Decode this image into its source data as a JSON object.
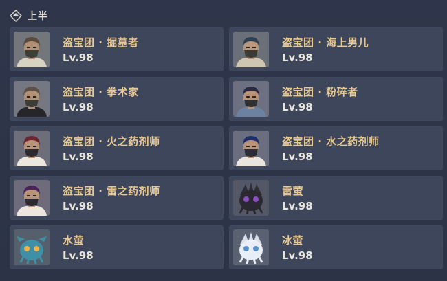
{
  "header": {
    "title": "上半",
    "icon": "diamond-icon"
  },
  "enemies": [
    {
      "name": "盗宝团 · 掘墓者",
      "level": "Lv.98",
      "portrait": "treasure-hoarder-gravedigger-icon",
      "colors": {
        "bg": "#73767a",
        "hair": "#5a4a3c",
        "skin": "#b08f74",
        "clothes": "#d8d2c2",
        "mask": "#3c3f36"
      }
    },
    {
      "name": "盗宝团 · 海上男儿",
      "level": "Lv.98",
      "portrait": "treasure-hoarder-seaman-icon",
      "colors": {
        "bg": "#6a6f78",
        "hair": "#2f3f52",
        "skin": "#b8977c",
        "clothes": "#cfc6b2",
        "mask": "#3a3c34"
      }
    },
    {
      "name": "盗宝团 · 拳术家",
      "level": "Lv.98",
      "portrait": "treasure-hoarder-handyman-icon",
      "colors": {
        "bg": "#767881",
        "hair": "#5c5048",
        "skin": "#b29076",
        "clothes": "#25252a",
        "mask": "#3b3d34"
      }
    },
    {
      "name": "盗宝团 · 粉碎者",
      "level": "Lv.98",
      "portrait": "treasure-hoarder-crusher-icon",
      "colors": {
        "bg": "#6d7080",
        "hair": "#2a2a44",
        "skin": "#b89378",
        "clothes": "#6d82a0",
        "mask": "#2e3032"
      }
    },
    {
      "name": "盗宝团 · 火之药剂师",
      "level": "Lv.98",
      "portrait": "pyro-potioneer-icon",
      "colors": {
        "bg": "#6e6e7a",
        "hair": "#6c2430",
        "skin": "#b89378",
        "clothes": "#ece6de",
        "mask": "#2c2a30"
      }
    },
    {
      "name": "盗宝团 · 水之药剂师",
      "level": "Lv.98",
      "portrait": "hydro-potioneer-icon",
      "colors": {
        "bg": "#6a6e7e",
        "hair": "#1f2f6c",
        "skin": "#b89378",
        "clothes": "#e8e4de",
        "mask": "#2b2d36"
      }
    },
    {
      "name": "盗宝团 · 雷之药剂师",
      "level": "Lv.98",
      "portrait": "electro-potioneer-icon",
      "colors": {
        "bg": "#6e6c7c",
        "hair": "#4a2458",
        "skin": "#b89378",
        "clothes": "#ece6de",
        "mask": "#2c2a30"
      }
    },
    {
      "name": "雷萤",
      "level": "Lv.98",
      "portrait": "electro-cicin-icon",
      "colors": {
        "bg": "#545766",
        "body": "#2a2830",
        "eyes": "#8e4ec4"
      }
    },
    {
      "name": "水萤",
      "level": "Lv.98",
      "portrait": "hydro-cicin-icon",
      "colors": {
        "bg": "#55606c",
        "body": "#3f8fa6",
        "eyes": "#f0b24a"
      }
    },
    {
      "name": "冰萤",
      "level": "Lv.98",
      "portrait": "cryo-cicin-icon",
      "colors": {
        "bg": "#5a6272",
        "body": "#e8eef6",
        "eyes": "#5a8fc8"
      }
    }
  ]
}
